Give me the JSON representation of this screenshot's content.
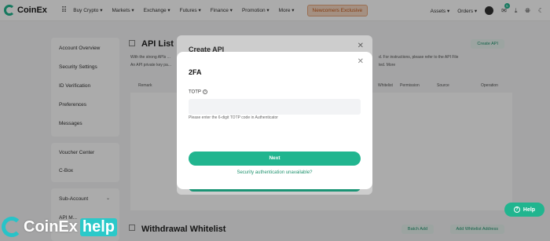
{
  "nav": {
    "logo": "CoinEx",
    "items": [
      "Buy Crypto ▾",
      "Markets ▾",
      "Exchange ▾",
      "Futures ▾",
      "Finance ▾",
      "Promotion ▾",
      "More ▾"
    ],
    "newcomers": "Newcomers Exclusive",
    "assets": "Assets ▾",
    "orders": "Orders ▾",
    "notif_count": "5"
  },
  "sidebar": {
    "items": [
      "Account Overview",
      "Security Settings",
      "ID Verification",
      "Preferences",
      "Messages"
    ],
    "items2": [
      "Voucher Center",
      "C-Box"
    ],
    "items3": [
      "Sub-Account",
      "API M..."
    ]
  },
  "main": {
    "title": "API List",
    "create_api": "Create API",
    "bullet1": "With the strong APIs ...",
    "bullet1_tail": "d. For instructions, please refer to the API File",
    "bullet2": "An API private key pa...",
    "bullet2_tail": "ted. More",
    "columns": [
      "Remark",
      "Whitelist",
      "Permission",
      "Source",
      "Operation"
    ],
    "ww_title": "Withdrawal Whitelist",
    "batch_add": "Batch Add",
    "add_ww": "Add Whitelist Address"
  },
  "behind_modal": {
    "title": "Create API"
  },
  "modal": {
    "title": "2FA",
    "label": "TOTP",
    "input_value": "",
    "hint": "Please enter the 6-digit TOTP code in Authenticator",
    "next": "Next",
    "link": "Security authentication unavailable?"
  },
  "help": "Help",
  "watermark": {
    "brand": "CoinEx",
    "help": "help"
  }
}
